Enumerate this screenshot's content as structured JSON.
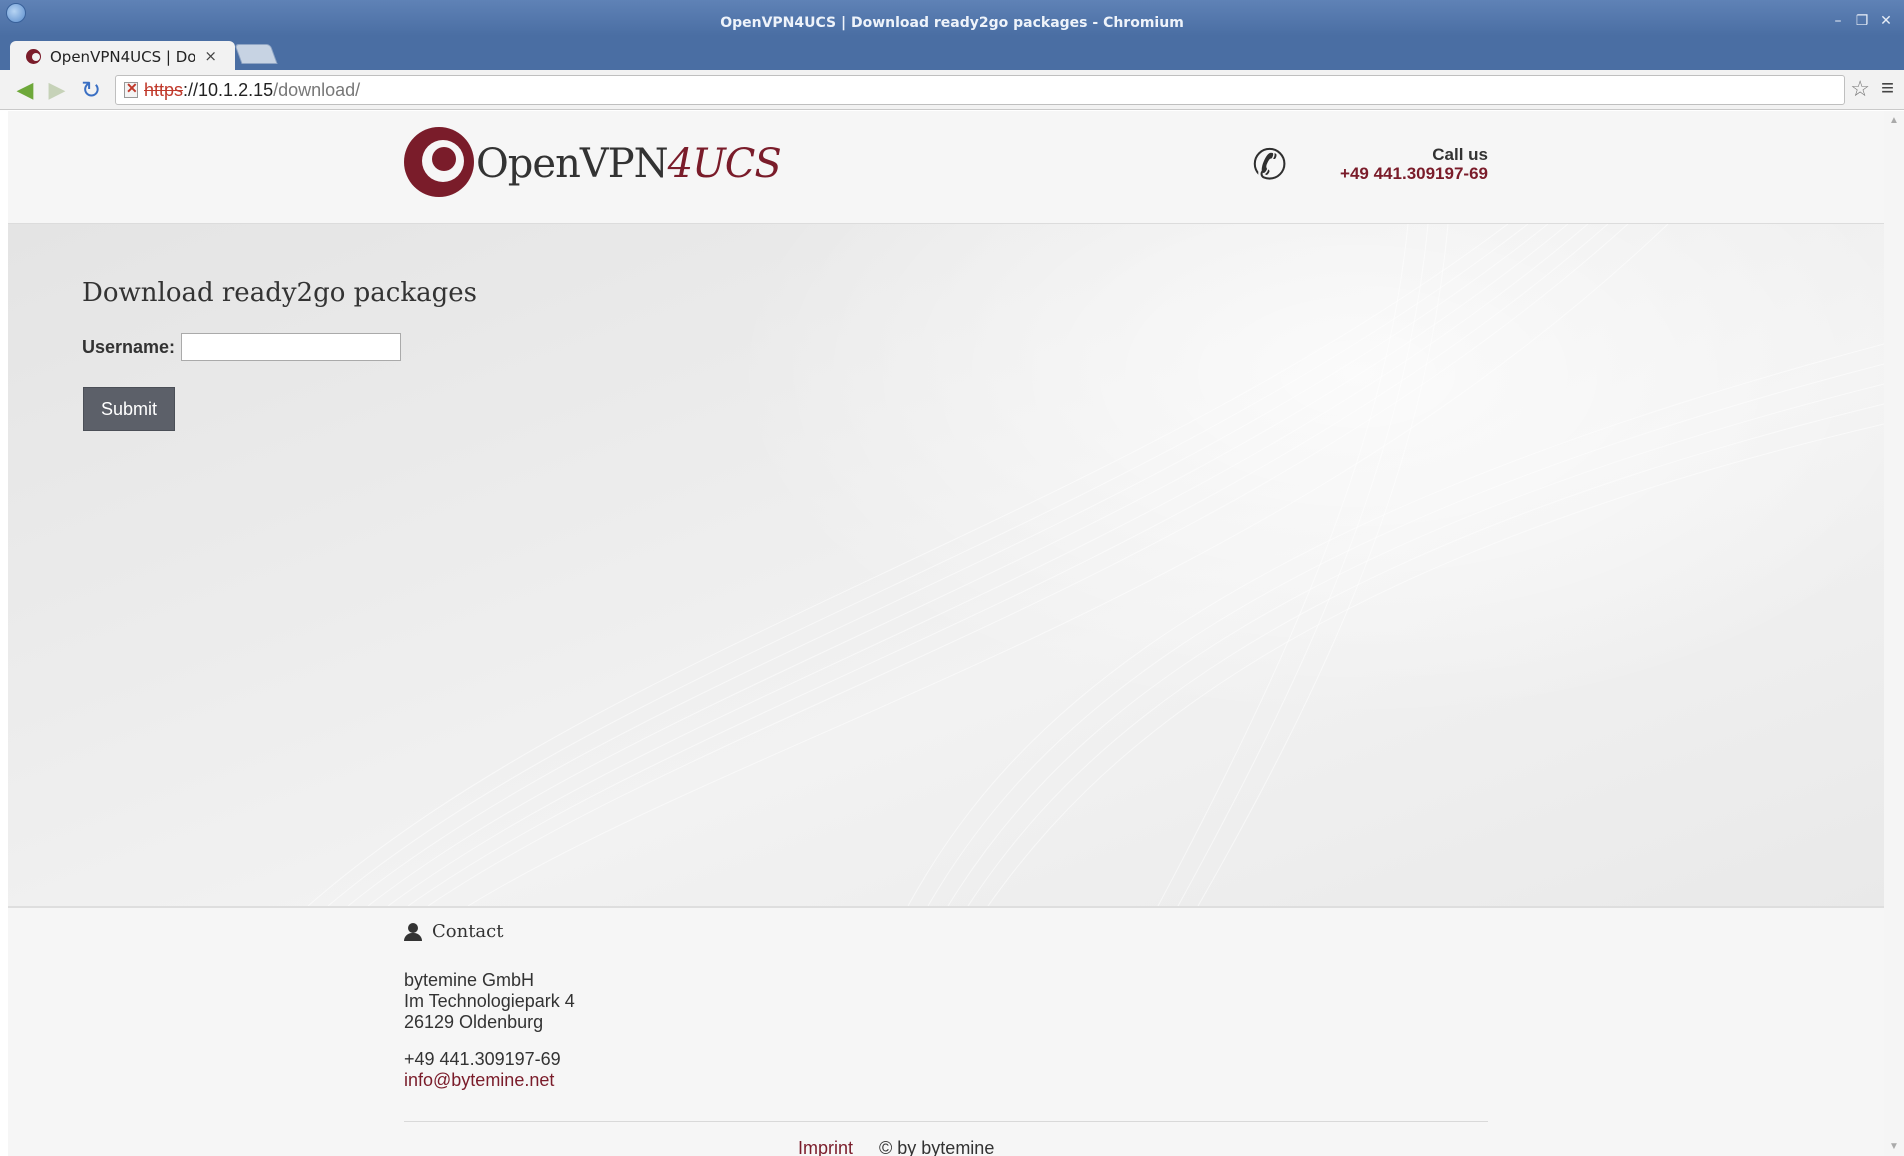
{
  "window": {
    "title": "OpenVPN4UCS | Download ready2go packages - Chromium",
    "controls": [
      "–",
      "❐",
      "✕"
    ]
  },
  "tab": {
    "label": "OpenVPN4UCS | Do",
    "close": "×"
  },
  "toolbar": {
    "url_scheme": "https",
    "url_host": "://10.1.2.15",
    "url_path": "/download/",
    "star": "☆",
    "menu": "≡"
  },
  "header": {
    "logo_text": "OpenVPN",
    "logo_accent": "4UCS",
    "call_label": "Call us",
    "call_number": "+49 441.309197-69"
  },
  "main": {
    "heading": "Download ready2go packages",
    "username_label": "Username:",
    "username_value": "",
    "submit_label": "Submit"
  },
  "footer": {
    "contact_heading": "Contact",
    "company": "bytemine GmbH",
    "street": "Im Technologiepark 4",
    "city": "26129 Oldenburg",
    "phone": "+49 441.309197-69",
    "email": "info@bytemine.net",
    "imprint": "Imprint",
    "copyright": "© by bytemine"
  },
  "colors": {
    "brand": "#7a1c2a",
    "titlebar": "#4a6ea3",
    "button": "#5c6069"
  },
  "icons": [
    "chromium-icon",
    "favicon-icon",
    "back-icon",
    "forward-icon",
    "reload-icon",
    "insecure-lock-icon",
    "star-icon",
    "menu-icon",
    "phone-icon",
    "person-icon"
  ]
}
